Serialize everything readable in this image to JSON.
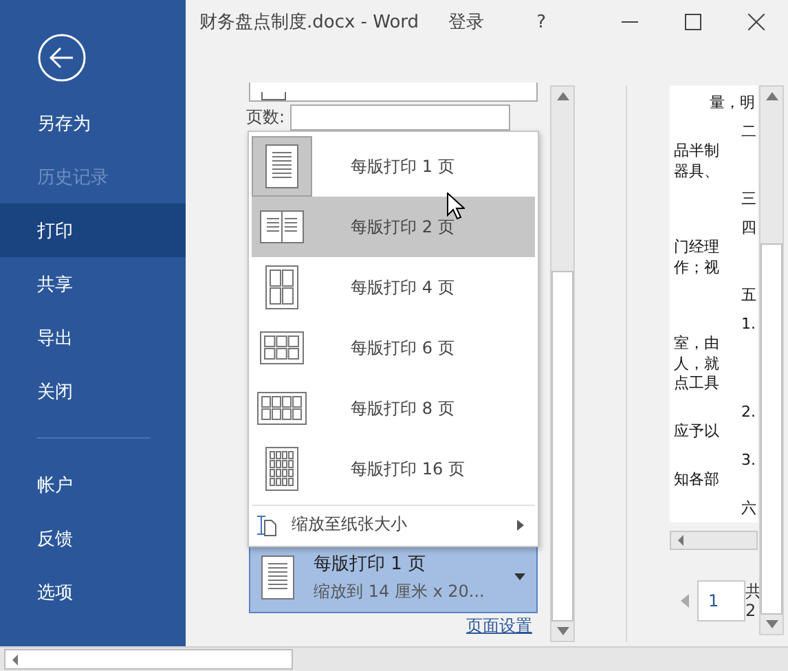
{
  "window": {
    "title": "财务盘点制度.docx  -  Word",
    "sign_in": "登录",
    "help": "?"
  },
  "sidebar": {
    "items": [
      {
        "label": "另存为",
        "disabled": false,
        "selected": false
      },
      {
        "label": "历史记录",
        "disabled": true,
        "selected": false
      },
      {
        "label": "打印",
        "disabled": false,
        "selected": true
      },
      {
        "label": "共享",
        "disabled": false,
        "selected": false
      },
      {
        "label": "导出",
        "disabled": false,
        "selected": false
      },
      {
        "label": "关闭",
        "disabled": false,
        "selected": false
      }
    ],
    "bottom_items": [
      {
        "label": "帐户",
        "selected": false
      },
      {
        "label": "反馈",
        "selected": false
      },
      {
        "label": "选项",
        "selected": false
      }
    ]
  },
  "print_settings": {
    "pages_label": "页数:"
  },
  "pages_per_sheet_menu": {
    "items": [
      {
        "kind": "one",
        "label": "每版打印 1 页",
        "selected": true,
        "highlighted": false
      },
      {
        "kind": "two",
        "label": "每版打印 2 页",
        "selected": false,
        "highlighted": true
      },
      {
        "kind": "four",
        "label": "每版打印 4 页",
        "selected": false,
        "highlighted": false
      },
      {
        "kind": "six",
        "label": "每版打印 6 页",
        "selected": false,
        "highlighted": false
      },
      {
        "kind": "eight",
        "label": "每版打印 8 页",
        "selected": false,
        "highlighted": false
      },
      {
        "kind": "sixteen",
        "label": "每版打印 16 页",
        "selected": false,
        "highlighted": false
      }
    ],
    "scale_item": "缩放至纸张大小"
  },
  "pages_per_sheet_button": {
    "title": "每版打印 1 页",
    "subtitle": "缩放到 14 厘米 x 20...",
    "expanded": true
  },
  "page_setup_link": "页面设置",
  "preview": {
    "lines": [
      {
        "kind": "mid",
        "text": "量，明"
      },
      {
        "kind": "start",
        "text": "二"
      },
      {
        "kind": "line",
        "text": "品半制"
      },
      {
        "kind": "line",
        "text": "器具、"
      },
      {
        "kind": "start",
        "text": "三"
      },
      {
        "kind": "start",
        "text": "四"
      },
      {
        "kind": "line",
        "text": "门经理"
      },
      {
        "kind": "line",
        "text": "作；视"
      },
      {
        "kind": "start",
        "text": "五"
      },
      {
        "kind": "start",
        "text": "1."
      },
      {
        "kind": "line",
        "text": "室，由"
      },
      {
        "kind": "line",
        "text": "人，就"
      },
      {
        "kind": "line",
        "text": "点工具"
      },
      {
        "kind": "start",
        "text": "2."
      },
      {
        "kind": "line",
        "text": "应予以"
      },
      {
        "kind": "start",
        "text": "3."
      },
      {
        "kind": "line",
        "text": "知各部"
      },
      {
        "kind": "start",
        "text": "六"
      }
    ],
    "page_number": "1",
    "total_label": "共",
    "total_pages": "2"
  }
}
